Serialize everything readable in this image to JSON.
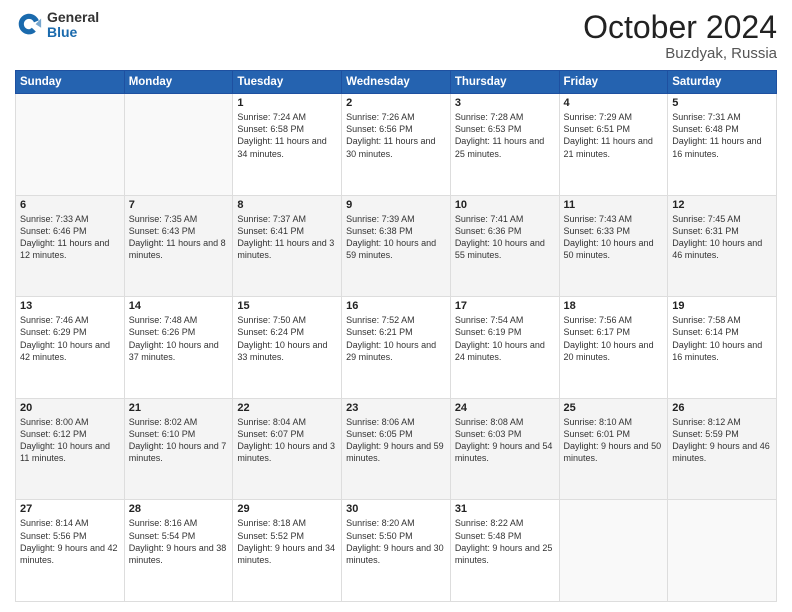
{
  "header": {
    "logo_general": "General",
    "logo_blue": "Blue",
    "month_title": "October 2024",
    "location": "Buzdyak, Russia"
  },
  "days_of_week": [
    "Sunday",
    "Monday",
    "Tuesday",
    "Wednesday",
    "Thursday",
    "Friday",
    "Saturday"
  ],
  "weeks": [
    [
      {
        "day": "",
        "sunrise": "",
        "sunset": "",
        "daylight": ""
      },
      {
        "day": "",
        "sunrise": "",
        "sunset": "",
        "daylight": ""
      },
      {
        "day": "1",
        "sunrise": "Sunrise: 7:24 AM",
        "sunset": "Sunset: 6:58 PM",
        "daylight": "Daylight: 11 hours and 34 minutes."
      },
      {
        "day": "2",
        "sunrise": "Sunrise: 7:26 AM",
        "sunset": "Sunset: 6:56 PM",
        "daylight": "Daylight: 11 hours and 30 minutes."
      },
      {
        "day": "3",
        "sunrise": "Sunrise: 7:28 AM",
        "sunset": "Sunset: 6:53 PM",
        "daylight": "Daylight: 11 hours and 25 minutes."
      },
      {
        "day": "4",
        "sunrise": "Sunrise: 7:29 AM",
        "sunset": "Sunset: 6:51 PM",
        "daylight": "Daylight: 11 hours and 21 minutes."
      },
      {
        "day": "5",
        "sunrise": "Sunrise: 7:31 AM",
        "sunset": "Sunset: 6:48 PM",
        "daylight": "Daylight: 11 hours and 16 minutes."
      }
    ],
    [
      {
        "day": "6",
        "sunrise": "Sunrise: 7:33 AM",
        "sunset": "Sunset: 6:46 PM",
        "daylight": "Daylight: 11 hours and 12 minutes."
      },
      {
        "day": "7",
        "sunrise": "Sunrise: 7:35 AM",
        "sunset": "Sunset: 6:43 PM",
        "daylight": "Daylight: 11 hours and 8 minutes."
      },
      {
        "day": "8",
        "sunrise": "Sunrise: 7:37 AM",
        "sunset": "Sunset: 6:41 PM",
        "daylight": "Daylight: 11 hours and 3 minutes."
      },
      {
        "day": "9",
        "sunrise": "Sunrise: 7:39 AM",
        "sunset": "Sunset: 6:38 PM",
        "daylight": "Daylight: 10 hours and 59 minutes."
      },
      {
        "day": "10",
        "sunrise": "Sunrise: 7:41 AM",
        "sunset": "Sunset: 6:36 PM",
        "daylight": "Daylight: 10 hours and 55 minutes."
      },
      {
        "day": "11",
        "sunrise": "Sunrise: 7:43 AM",
        "sunset": "Sunset: 6:33 PM",
        "daylight": "Daylight: 10 hours and 50 minutes."
      },
      {
        "day": "12",
        "sunrise": "Sunrise: 7:45 AM",
        "sunset": "Sunset: 6:31 PM",
        "daylight": "Daylight: 10 hours and 46 minutes."
      }
    ],
    [
      {
        "day": "13",
        "sunrise": "Sunrise: 7:46 AM",
        "sunset": "Sunset: 6:29 PM",
        "daylight": "Daylight: 10 hours and 42 minutes."
      },
      {
        "day": "14",
        "sunrise": "Sunrise: 7:48 AM",
        "sunset": "Sunset: 6:26 PM",
        "daylight": "Daylight: 10 hours and 37 minutes."
      },
      {
        "day": "15",
        "sunrise": "Sunrise: 7:50 AM",
        "sunset": "Sunset: 6:24 PM",
        "daylight": "Daylight: 10 hours and 33 minutes."
      },
      {
        "day": "16",
        "sunrise": "Sunrise: 7:52 AM",
        "sunset": "Sunset: 6:21 PM",
        "daylight": "Daylight: 10 hours and 29 minutes."
      },
      {
        "day": "17",
        "sunrise": "Sunrise: 7:54 AM",
        "sunset": "Sunset: 6:19 PM",
        "daylight": "Daylight: 10 hours and 24 minutes."
      },
      {
        "day": "18",
        "sunrise": "Sunrise: 7:56 AM",
        "sunset": "Sunset: 6:17 PM",
        "daylight": "Daylight: 10 hours and 20 minutes."
      },
      {
        "day": "19",
        "sunrise": "Sunrise: 7:58 AM",
        "sunset": "Sunset: 6:14 PM",
        "daylight": "Daylight: 10 hours and 16 minutes."
      }
    ],
    [
      {
        "day": "20",
        "sunrise": "Sunrise: 8:00 AM",
        "sunset": "Sunset: 6:12 PM",
        "daylight": "Daylight: 10 hours and 11 minutes."
      },
      {
        "day": "21",
        "sunrise": "Sunrise: 8:02 AM",
        "sunset": "Sunset: 6:10 PM",
        "daylight": "Daylight: 10 hours and 7 minutes."
      },
      {
        "day": "22",
        "sunrise": "Sunrise: 8:04 AM",
        "sunset": "Sunset: 6:07 PM",
        "daylight": "Daylight: 10 hours and 3 minutes."
      },
      {
        "day": "23",
        "sunrise": "Sunrise: 8:06 AM",
        "sunset": "Sunset: 6:05 PM",
        "daylight": "Daylight: 9 hours and 59 minutes."
      },
      {
        "day": "24",
        "sunrise": "Sunrise: 8:08 AM",
        "sunset": "Sunset: 6:03 PM",
        "daylight": "Daylight: 9 hours and 54 minutes."
      },
      {
        "day": "25",
        "sunrise": "Sunrise: 8:10 AM",
        "sunset": "Sunset: 6:01 PM",
        "daylight": "Daylight: 9 hours and 50 minutes."
      },
      {
        "day": "26",
        "sunrise": "Sunrise: 8:12 AM",
        "sunset": "Sunset: 5:59 PM",
        "daylight": "Daylight: 9 hours and 46 minutes."
      }
    ],
    [
      {
        "day": "27",
        "sunrise": "Sunrise: 8:14 AM",
        "sunset": "Sunset: 5:56 PM",
        "daylight": "Daylight: 9 hours and 42 minutes."
      },
      {
        "day": "28",
        "sunrise": "Sunrise: 8:16 AM",
        "sunset": "Sunset: 5:54 PM",
        "daylight": "Daylight: 9 hours and 38 minutes."
      },
      {
        "day": "29",
        "sunrise": "Sunrise: 8:18 AM",
        "sunset": "Sunset: 5:52 PM",
        "daylight": "Daylight: 9 hours and 34 minutes."
      },
      {
        "day": "30",
        "sunrise": "Sunrise: 8:20 AM",
        "sunset": "Sunset: 5:50 PM",
        "daylight": "Daylight: 9 hours and 30 minutes."
      },
      {
        "day": "31",
        "sunrise": "Sunrise: 8:22 AM",
        "sunset": "Sunset: 5:48 PM",
        "daylight": "Daylight: 9 hours and 25 minutes."
      },
      {
        "day": "",
        "sunrise": "",
        "sunset": "",
        "daylight": ""
      },
      {
        "day": "",
        "sunrise": "",
        "sunset": "",
        "daylight": ""
      }
    ]
  ]
}
